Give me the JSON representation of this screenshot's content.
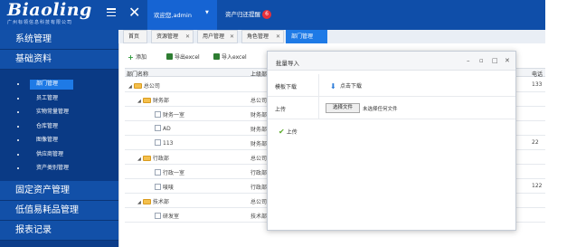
{
  "header": {
    "logo_text": "Biaoling",
    "logo_sub": "广州标领信息科技有限公司",
    "user_label": "欢迎您,admin",
    "remind_label": "资产归还提醒",
    "remind_count": "6"
  },
  "sidebar": {
    "sections": [
      {
        "label": "系统管理"
      },
      {
        "label": "基础资料"
      }
    ],
    "items": [
      {
        "label": "部门管理",
        "active": true
      },
      {
        "label": "员工管理"
      },
      {
        "label": "实物常量管理"
      },
      {
        "label": "仓库管理"
      },
      {
        "label": "图像管理"
      },
      {
        "label": "供应商管理"
      },
      {
        "label": "资产类别管理"
      }
    ],
    "bottom_sections": [
      {
        "label": "固定资产管理"
      },
      {
        "label": "低值易耗品管理"
      },
      {
        "label": "报表记录"
      }
    ]
  },
  "tabs": [
    {
      "label": "首页"
    },
    {
      "label": "资源管理"
    },
    {
      "label": "用户管理"
    },
    {
      "label": "角色管理"
    },
    {
      "label": "部门管理"
    }
  ],
  "toolbar": {
    "add_label": "添加",
    "export_label": "导出excel",
    "import_label": "导入excel"
  },
  "grid": {
    "col_name": "部门名称",
    "col_parent": "上级部门",
    "col_phone": "电话",
    "rows": [
      {
        "name": "总公司",
        "parent": "",
        "phone": "133"
      },
      {
        "name": "财务部",
        "parent": "总公司",
        "phone": ""
      },
      {
        "name": "财务一室",
        "parent": "财务部",
        "phone": ""
      },
      {
        "name": "AD",
        "parent": "财务部",
        "phone": ""
      },
      {
        "name": "113",
        "parent": "财务部",
        "phone": "22"
      },
      {
        "name": "行政部",
        "parent": "总公司",
        "phone": ""
      },
      {
        "name": "行政一室",
        "parent": "行政部",
        "phone": ""
      },
      {
        "name": "唛唛",
        "parent": "行政部",
        "phone": "122"
      },
      {
        "name": "技术部",
        "parent": "总公司",
        "phone": ""
      },
      {
        "name": "研发室",
        "parent": "技术部",
        "phone": ""
      }
    ]
  },
  "modal": {
    "title": "批量导入",
    "template_label": "模板下载",
    "download_link": "点击下载",
    "upload_label": "上传",
    "choose_file_button": "选择文件",
    "file_status": "未选择任何文件",
    "submit_label": "上传"
  }
}
